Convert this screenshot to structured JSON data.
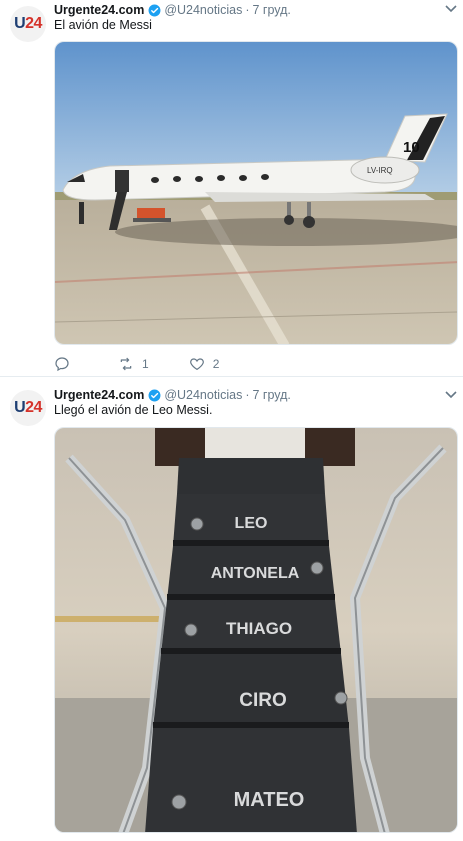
{
  "tweets": [
    {
      "author": "Urgente24.com",
      "handle": "@U24noticias",
      "separator": "·",
      "time": "7 груд.",
      "text": "El avión de Messi",
      "image_text": {
        "tail_number": "10",
        "registration": "LV-IRQ"
      },
      "actions": {
        "reply_count": "",
        "retweet_count": "1",
        "like_count": "2"
      }
    },
    {
      "author": "Urgente24.com",
      "handle": "@U24noticias",
      "separator": "·",
      "time": "7 груд.",
      "text": "Llegó el avión de Leo Messi.",
      "image_text": {
        "steps": [
          "LEO",
          "ANTONELA",
          "THIAGO",
          "CIRO",
          "MATEO"
        ]
      }
    }
  ],
  "avatar": {
    "prefix": "U",
    "number": "24"
  },
  "colors": {
    "verified": "#1da1f2",
    "brand_blue": "#1f3f73",
    "brand_red": "#d5322a"
  }
}
